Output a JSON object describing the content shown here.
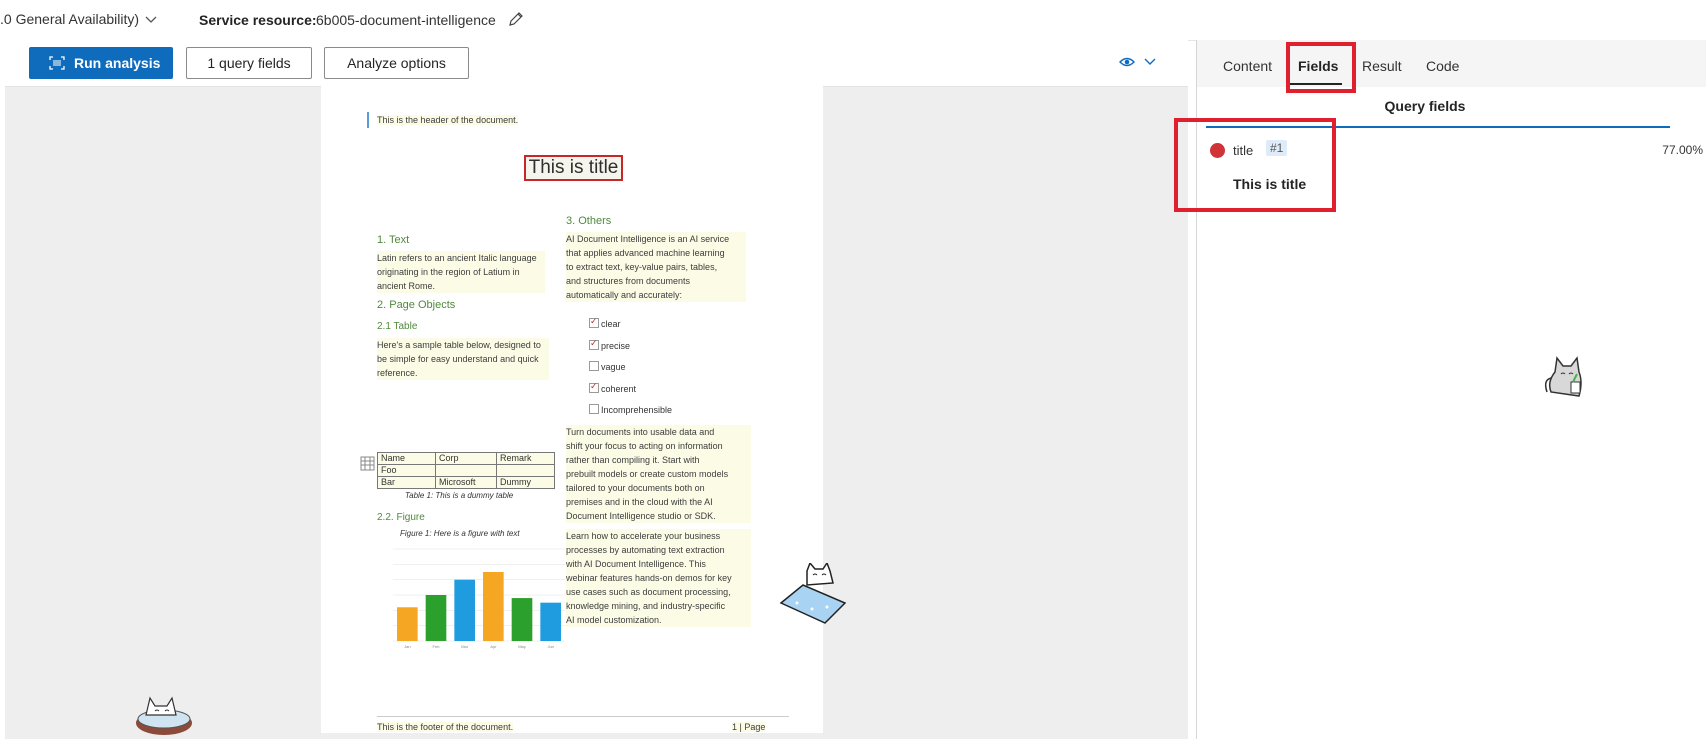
{
  "topbar": {
    "version": ".0 General Availability)",
    "service_label": "Service resource:",
    "service_value": "6b005-document-intelligence",
    "chevron_icon": "chevron-down-icon",
    "edit_icon": "pencil-icon"
  },
  "toolbar": {
    "run_label": "Run analysis",
    "query_fields_label": "1 query fields",
    "analyze_options_label": "Analyze options",
    "view_icon": "eye-icon"
  },
  "document": {
    "header": "This is the header of the document.",
    "title": "This is title",
    "sec1_heading": "1. Text",
    "sec1_body": [
      "Latin refers to an ancient Italic language",
      "originating in the region of Latium in",
      "ancient Rome."
    ],
    "sec2_heading": "2. Page Objects",
    "sec21_heading": "2.1 Table",
    "sec21_body": [
      "Here's a sample table below, designed to",
      "be simple for easy understand and quick",
      "reference."
    ],
    "table": [
      [
        "Name",
        "Corp",
        "Remark"
      ],
      [
        "Foo",
        "",
        ""
      ],
      [
        "Bar",
        "Microsoft",
        "Dummy"
      ]
    ],
    "table_caption": "Table 1: This is a dummy table",
    "sec22_heading": "2.2. Figure",
    "figure_caption": "Figure 1: Here is a figure with text",
    "sec3_heading": "3. Others",
    "sec3_body": [
      "AI Document Intelligence is an AI service",
      "that applies advanced machine learning",
      "to extract text, key-value pairs, tables,",
      "and structures from documents",
      "automatically and accurately:"
    ],
    "checkboxes": [
      {
        "label": "clear",
        "checked": true
      },
      {
        "label": "precise",
        "checked": true
      },
      {
        "label": "vague",
        "checked": false
      },
      {
        "label": "coherent",
        "checked": true
      },
      {
        "label": "Incomprehensible",
        "checked": false
      }
    ],
    "para2": [
      "Turn documents into usable data and",
      "shift your focus to acting on information",
      "rather than compiling it. Start with",
      "prebuilt models or create custom models",
      "tailored to your documents both on",
      "premises and in the cloud with the AI",
      "Document Intelligence studio or SDK."
    ],
    "para3": [
      "Learn how to accelerate your business",
      "processes by automating text extraction",
      "with AI Document Intelligence. This",
      "webinar features hands-on demos for key",
      "use cases such as document processing,",
      "knowledge mining, and industry-specific",
      "AI model customization."
    ],
    "footer_left": "This is the footer of the document.",
    "footer_right": "1 | Page"
  },
  "chart_data": {
    "type": "bar",
    "categories": [
      "Jan",
      "Feb",
      "Mar",
      "Apr",
      "May",
      "Jun"
    ],
    "values": [
      220,
      300,
      400,
      450,
      280,
      250
    ],
    "ylim": [
      0,
      600
    ],
    "colors": [
      "#f5a623",
      "#2ca02c",
      "#1f9be0",
      "#f5a623",
      "#2ca02c",
      "#1f9be0"
    ]
  },
  "panel": {
    "tabs": [
      "Content",
      "Fields",
      "Result",
      "Code"
    ],
    "active_tab": "Fields",
    "query_fields_title": "Query fields",
    "field": {
      "name": "title",
      "badge": "#1",
      "confidence": "77.00%",
      "value": "This is title",
      "color": "#d13438"
    }
  },
  "colors": {
    "primary": "#0f6cbd",
    "highlight": "#e1202f"
  }
}
